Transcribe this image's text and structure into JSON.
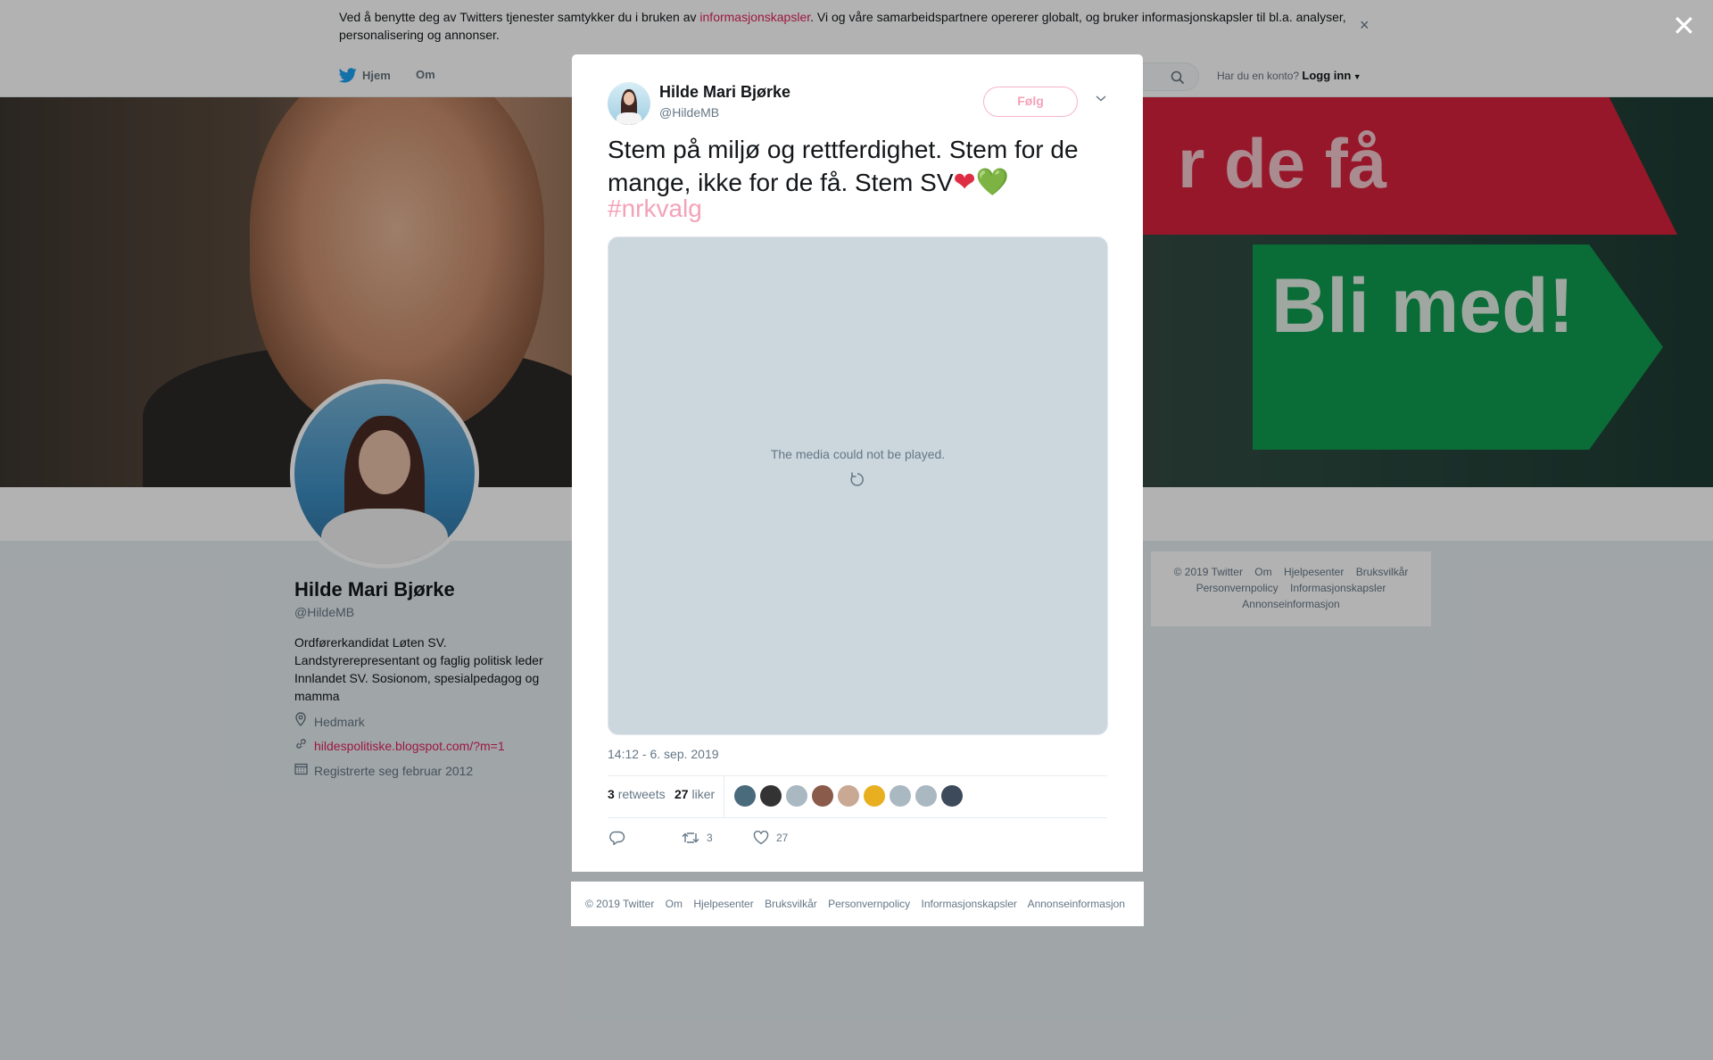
{
  "cookie_banner": {
    "text_before": "Ved å benytte deg av Twitters tjenester samtykker du i bruken av ",
    "link": "informasjonskapsler",
    "text_after": ". Vi og våre samarbeidspartnere opererer globalt, og bruker informasjonskapsler til bl.a. analyser, personalisering og annonser.",
    "close": "×"
  },
  "topnav": {
    "home_label": "Hjem",
    "about_label": "Om",
    "login_prompt": "Har du en konto?",
    "login_label": "Logg inn"
  },
  "banner": {
    "text_red": "r de få",
    "text_green": "Bli med!"
  },
  "profile": {
    "name": "Hilde Mari Bjørke",
    "handle": "@HildeMB",
    "bio": "Ordførerkandidat Løten SV. Landstyrerepresentant og faglig politisk leder Innlandet SV. Sosionom, spesialpedagog og mamma",
    "location": "Hedmark",
    "website": "hildespolitiske.blogspot.com/?m=1",
    "joined": "Registrerte seg februar 2012"
  },
  "side_footer": {
    "links": [
      "© 2019 Twitter",
      "Om",
      "Hjelpesenter",
      "Bruksvilkår",
      "Personvernpolicy",
      "Informasjonskapsler",
      "Annonseinformasjon"
    ]
  },
  "overlay": {
    "close": "✕"
  },
  "tweet": {
    "name": "Hilde Mari Bjørke",
    "handle": "@HildeMB",
    "follow_label": "Følg",
    "text": "Stem på miljø og rettferdighet. Stem for de mange, ikke for de få. Stem SV",
    "emoji_red": "❤",
    "emoji_green": "💚",
    "hashtag": "#nrkvalg",
    "media_message": "The media could not be played.",
    "timestamp": "14:12 - 6. sep. 2019",
    "retweets_count": "3",
    "retweets_label": "retweets",
    "likes_count": "27",
    "likes_label": "liker",
    "liker_colors": [
      "#4a6b7c",
      "#333333",
      "#aab8c2",
      "#8a5a4a",
      "#c9a894",
      "#e8b020",
      "#aab8c2",
      "#aab8c2",
      "#3d4a5c"
    ],
    "actions": {
      "reply_count": "",
      "retweet_count": "3",
      "like_count": "27"
    }
  },
  "modal_footer": {
    "links": [
      "© 2019 Twitter",
      "Om",
      "Hjelpesenter",
      "Bruksvilkår",
      "Personvernpolicy",
      "Informasjonskapsler",
      "Annonseinformasjon"
    ]
  },
  "colors": {
    "accent": "#e0245e",
    "follow_border": "#f6b3c6",
    "text_secondary": "#657786"
  }
}
